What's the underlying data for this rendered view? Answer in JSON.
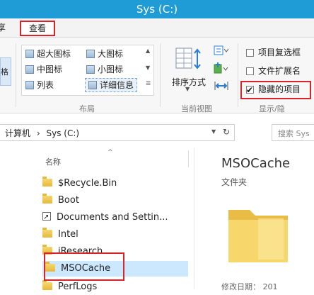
{
  "window": {
    "title": "Sys (C:)"
  },
  "tabs": {
    "share_partial": "享",
    "view": "查看"
  },
  "ribbon": {
    "layout": {
      "left_button_partial": "格",
      "options": [
        {
          "label": "超大图标"
        },
        {
          "label": "大图标"
        },
        {
          "label": "中图标"
        },
        {
          "label": "小图标"
        },
        {
          "label": "列表"
        },
        {
          "label": "详细信息"
        }
      ],
      "group_label": "布局"
    },
    "current_view": {
      "sort_by": "排序方式",
      "group_label": "当前视图"
    },
    "show_hide": {
      "checkboxes": [
        {
          "label": "项目复选框",
          "checked": false
        },
        {
          "label": "文件扩展名",
          "checked": false
        },
        {
          "label": "隐藏的项目",
          "checked": true
        }
      ],
      "group_label": "显示/隐"
    }
  },
  "address": {
    "breadcrumb": [
      "计算机",
      "Sys (C:)"
    ],
    "dropdown_icon": "chevron-down-icon",
    "refresh_icon": "refresh-icon",
    "search_placeholder": "搜索 Sys"
  },
  "file_list": {
    "column_header": "名称",
    "items": [
      {
        "name": "$Recycle.Bin",
        "type": "folder"
      },
      {
        "name": "Boot",
        "type": "folder"
      },
      {
        "name": "Documents and Settin...",
        "type": "shortcut"
      },
      {
        "name": "Intel",
        "type": "folder"
      },
      {
        "name": "iResearch",
        "type": "folder"
      },
      {
        "name": "MSOCache",
        "type": "folder",
        "selected": true
      },
      {
        "name": "PerfLogs",
        "type": "folder"
      }
    ]
  },
  "preview": {
    "name": "MSOCache",
    "type": "文件夹",
    "modified_partial": "修改日期：  201"
  },
  "colors": {
    "titlebar": "#1f9bd6",
    "highlight_outline": "#d8232a",
    "selection": "#cce8ff"
  }
}
